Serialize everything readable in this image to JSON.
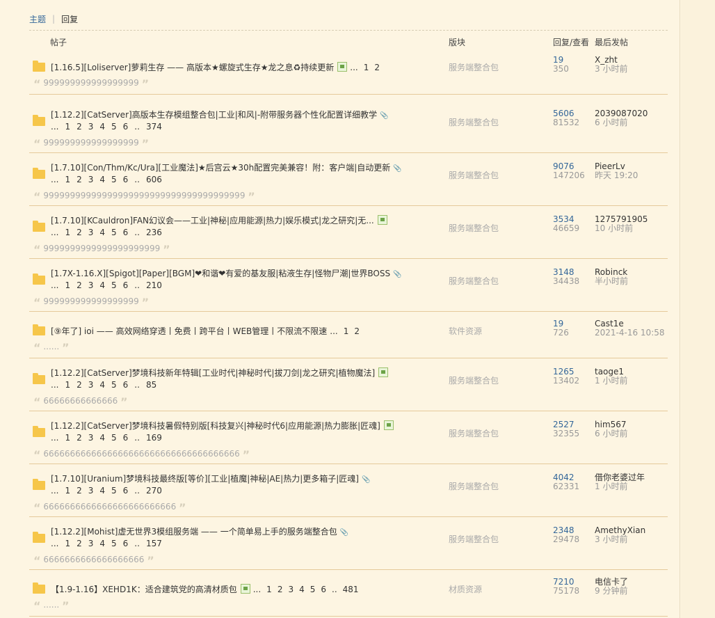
{
  "tabs": {
    "topics": "主题",
    "replies": "回复"
  },
  "header": {
    "post": "帖子",
    "forum": "版块",
    "stats": "回复/查看",
    "last": "最后发帖"
  },
  "rows": [
    {
      "title": "[1.16.5][Loliserver]萝莉生存 —— 高版本★螺旋式生存★龙之息♻持续更新",
      "icon": "image-icon",
      "inline_pages": [
        "...",
        "1",
        "2"
      ],
      "pages": [],
      "forum": "服务端整合包",
      "replies": "19",
      "views": "350",
      "last_user": "X_zht",
      "last_time": "3 小时前",
      "quote": "999999999999999999"
    },
    {
      "title": "[1.12.2][CatServer]高版本生存模组整合包|工业|和风|-附带服务器个性化配置详细教学",
      "icon": "attachment-icon",
      "inline_pages": [],
      "pages": [
        "...",
        "1",
        "2",
        "3",
        "4",
        "5",
        "6",
        "..",
        "374"
      ],
      "forum": "服务端整合包",
      "replies": "5606",
      "views": "81532",
      "last_user": "2039087020",
      "last_time": "6 小时前",
      "quote": "999999999999999999"
    },
    {
      "title": "[1.7.10][Con/Thm/Kc/Ura][工业魔法]★后宫云★30h配置完美兼容！附：客户端|自动更新",
      "icon": "attachment-icon",
      "inline_pages": [],
      "pages": [
        "...",
        "1",
        "2",
        "3",
        "4",
        "5",
        "6",
        "..",
        "606"
      ],
      "forum": "服务端整合包",
      "replies": "9076",
      "views": "147206",
      "last_user": "PieerLv",
      "last_time": "昨天 19:20",
      "quote": "99999999999999999999999999999999999999"
    },
    {
      "title": "[1.7.10][KCauldron]FAN幻议会——工业|神秘|应用能源|热力|娱乐模式|龙之研究|无...",
      "icon": "image-icon",
      "inline_pages": [],
      "pages": [
        "...",
        "1",
        "2",
        "3",
        "4",
        "5",
        "6",
        "..",
        "236"
      ],
      "forum": "服务端整合包",
      "replies": "3534",
      "views": "46659",
      "last_user": "1275791905",
      "last_time": "10 小时前",
      "quote": "9999999999999999999999"
    },
    {
      "title": "[1.7X-1.16.X][Spigot][Paper][BGM]❤和谐❤有爱的基友服|粘液生存|怪物尸潮|世界BOSS",
      "icon": "attachment-icon",
      "inline_pages": [],
      "pages": [
        "...",
        "1",
        "2",
        "3",
        "4",
        "5",
        "6",
        "..",
        "210"
      ],
      "forum": "服务端整合包",
      "replies": "3148",
      "views": "34438",
      "last_user": "Robinck",
      "last_time": "半小时前",
      "quote": "999999999999999999"
    },
    {
      "title": "[⑨年了] ioi —— 高效网络穿透丨免费丨跨平台丨WEB管理丨不限流不限速",
      "icon": "",
      "inline_pages": [
        "...",
        "1",
        "2"
      ],
      "pages": [],
      "forum": "软件资源",
      "replies": "19",
      "views": "726",
      "last_user": "Cast1e",
      "last_time": "2021-4-16 10:58",
      "quote": "......"
    },
    {
      "title": "[1.12.2][CatServer]梦境科技新年特辑[工业时代|神秘时代|拔刀剑|龙之研究|植物魔法]",
      "icon": "image-icon",
      "inline_pages": [],
      "pages": [
        "...",
        "1",
        "2",
        "3",
        "4",
        "5",
        "6",
        "..",
        "85"
      ],
      "forum": "服务端整合包",
      "replies": "1265",
      "views": "13402",
      "last_user": "taoge1",
      "last_time": "1 小时前",
      "quote": "66666666666666"
    },
    {
      "title": "[1.12.2][CatServer]梦境科技暑假特别版[科技复兴|神秘时代6|应用能源|热力膨胀|匠魂]",
      "icon": "image-icon",
      "inline_pages": [],
      "pages": [
        "...",
        "1",
        "2",
        "3",
        "4",
        "5",
        "6",
        "..",
        "169"
      ],
      "forum": "服务端整合包",
      "replies": "2527",
      "views": "32355",
      "last_user": "him567",
      "last_time": "6 小时前",
      "quote": "6666666666666666666666666666666666666"
    },
    {
      "title": "[1.7.10][Uranium]梦境科技最终版[等价][工业|植魔|神秘|AE|热力|更多箱子|匠魂]",
      "icon": "attachment-icon",
      "inline_pages": [],
      "pages": [
        "...",
        "1",
        "2",
        "3",
        "4",
        "5",
        "6",
        "..",
        "270"
      ],
      "forum": "服务端整合包",
      "replies": "4042",
      "views": "62331",
      "last_user": "借你老婆过年",
      "last_time": "1 小时前",
      "quote": "6666666666666666666666666"
    },
    {
      "title": "[1.12.2][Mohist]虚无世界3模组服务端 —— 一个简单易上手的服务端整合包",
      "icon": "attachment-icon",
      "inline_pages": [],
      "pages": [
        "...",
        "1",
        "2",
        "3",
        "4",
        "5",
        "6",
        "..",
        "157"
      ],
      "forum": "服务端整合包",
      "replies": "2348",
      "views": "29478",
      "last_user": "AmethyXian",
      "last_time": "3 小时前",
      "quote": "6666666666666666666"
    },
    {
      "title": "【1.9-1.16】XEHD1K：适合建筑党的高清材质包",
      "icon": "image-icon",
      "inline_pages": [
        "...",
        "1",
        "2",
        "3",
        "4",
        "5",
        "6",
        "..",
        "481"
      ],
      "pages": [],
      "forum": "材质资源",
      "replies": "7210",
      "views": "75178",
      "last_user": "电信卡了",
      "last_time": "9 分钟前",
      "quote": "......"
    }
  ]
}
